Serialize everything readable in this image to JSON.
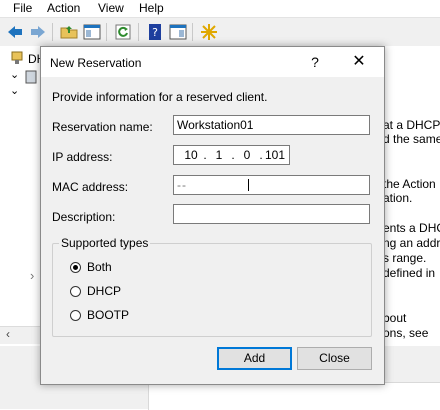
{
  "menubar": {
    "items": [
      "File",
      "Action",
      "View",
      "Help"
    ]
  },
  "tree": {
    "root_label": "DH"
  },
  "right_pane": {
    "lines": [
      "at a DHCP",
      "d the same",
      "",
      "",
      "the Action",
      "ation.",
      "",
      "ents a DHC",
      "ng an addr",
      "s range.",
      " defined in",
      "",
      "",
      "bout",
      "ons, see"
    ]
  },
  "dialog": {
    "title": "New Reservation",
    "help_glyph": "?",
    "close_glyph": "✕",
    "intro": "Provide information for a reserved client.",
    "reservation_name": {
      "label": "Reservation name:",
      "value": "Workstation01"
    },
    "ip_address": {
      "label": "IP address:",
      "octets": [
        "10",
        "1",
        "0",
        "101"
      ]
    },
    "mac_address": {
      "label": "MAC address:",
      "value": "--"
    },
    "description": {
      "label": "Description:",
      "value": ""
    },
    "supported_types": {
      "legend": "Supported types",
      "options": [
        {
          "label": "Both",
          "selected": true
        },
        {
          "label": "DHCP",
          "selected": false
        },
        {
          "label": "BOOTP",
          "selected": false
        }
      ]
    },
    "add_label": "Add",
    "close_label": "Close"
  },
  "colors": {
    "toolbar_blue": "#1e73be",
    "toolbar_green": "#2e8b2e",
    "default_button_border": "#0078d7"
  }
}
